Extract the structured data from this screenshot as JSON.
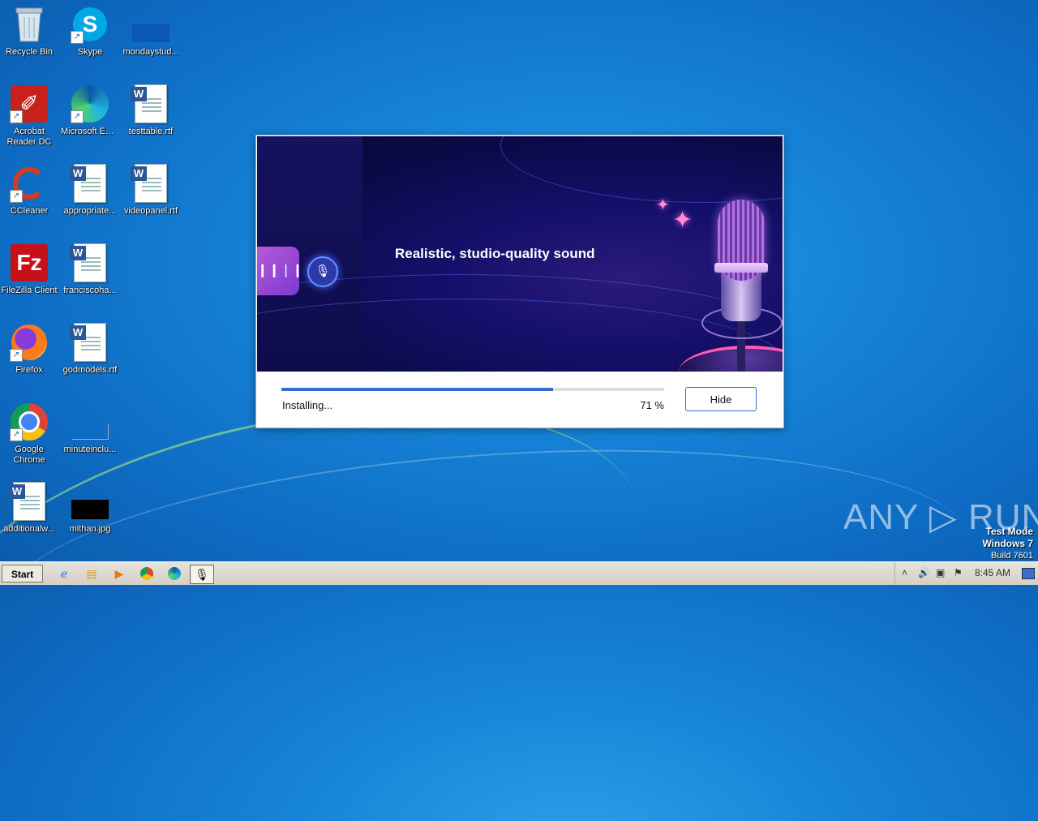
{
  "desktop": {
    "icons": [
      {
        "label": "Recycle Bin",
        "icon": "recycle-bin-icon"
      },
      {
        "label": "Skype",
        "icon": "skype-icon"
      },
      {
        "label": "mondaystud...",
        "icon": "blank-file-icon"
      },
      {
        "label": "Acrobat Reader DC",
        "icon": "acrobat-icon"
      },
      {
        "label": "Microsoft Edge",
        "icon": "edge-icon"
      },
      {
        "label": "testtable.rtf",
        "icon": "word-doc-icon"
      },
      {
        "label": "CCleaner",
        "icon": "ccleaner-icon"
      },
      {
        "label": "appropriate...",
        "icon": "word-doc-icon"
      },
      {
        "label": "videopanel.rtf",
        "icon": "word-doc-icon"
      },
      {
        "label": "FileZilla Client",
        "icon": "filezilla-icon"
      },
      {
        "label": "franciscoha...",
        "icon": "word-doc-icon"
      },
      {
        "label": "Firefox",
        "icon": "firefox-icon"
      },
      {
        "label": "godmodels.rtf",
        "icon": "word-doc-icon"
      },
      {
        "label": "Google Chrome",
        "icon": "chrome-icon"
      },
      {
        "label": "minuteinclu...",
        "icon": "blank-file-icon"
      },
      {
        "label": "additionalw...",
        "icon": "word-doc-icon"
      },
      {
        "label": "mithan.jpg",
        "icon": "image-file-icon"
      }
    ]
  },
  "installer": {
    "headline": "Realistic, studio-quality sound",
    "status": "Installing...",
    "percent_label": "71 %",
    "progress": 0.71,
    "hide_label": "Hide",
    "wave_glyph": "❙❙❘❙❘",
    "mic_glyph": "🎙"
  },
  "watermark": {
    "brand": "ANY ▷ RUN",
    "test_mode": "Test Mode",
    "os": "Windows 7",
    "build": "Build 7601"
  },
  "taskbar": {
    "start_label": "Start",
    "clock": "8:45 AM",
    "pinned": [
      "internet-explorer-icon",
      "file-explorer-icon",
      "media-player-icon",
      "chrome-icon",
      "edge-icon",
      "installer-app-icon"
    ]
  },
  "colors": {
    "accent": "#2f6fd6",
    "banner": "#0b0a48"
  }
}
